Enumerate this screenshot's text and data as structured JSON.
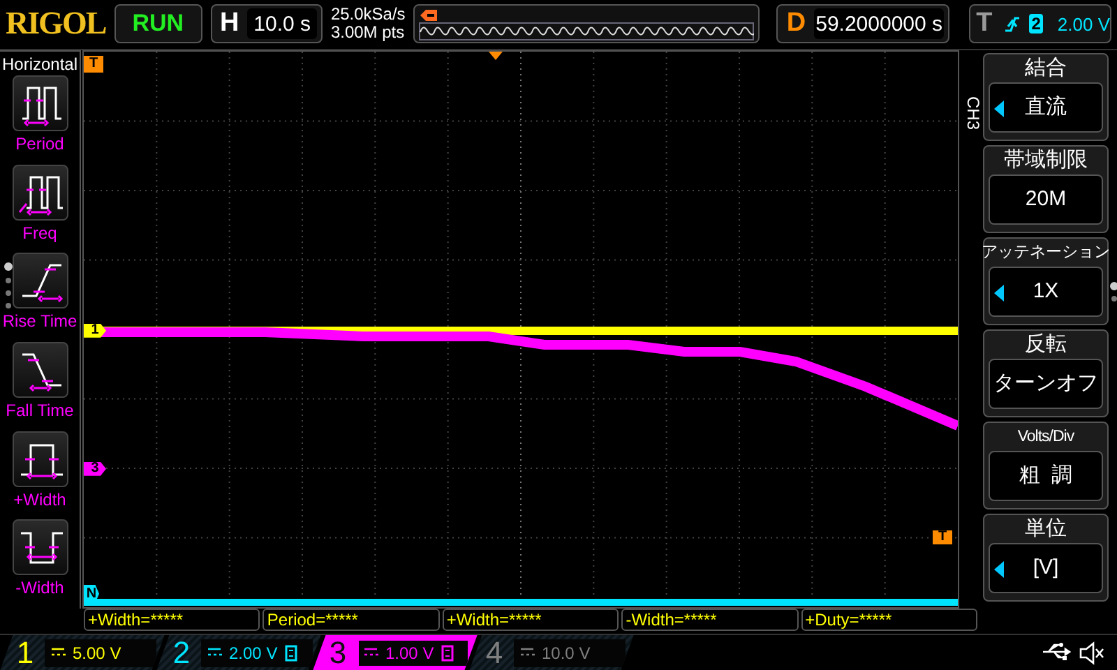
{
  "brand": "RIGOL",
  "run_state": {
    "label": "RUN",
    "running": true
  },
  "timebase": {
    "label": "H",
    "value": "10.0 s"
  },
  "acquisition": {
    "sample_rate": "25.0kSa/s",
    "memory_depth": "3.00M pts"
  },
  "delay": {
    "label": "D",
    "value": "59.2000000 s"
  },
  "trigger": {
    "label": "T",
    "source": "2",
    "level": "2.00 V",
    "color": "#00e5ff"
  },
  "measure_menu": {
    "title": "Horizontal",
    "items": [
      {
        "label": "Period",
        "kind": "period"
      },
      {
        "label": "Freq",
        "kind": "freq"
      },
      {
        "label": "Rise Time",
        "kind": "rise"
      },
      {
        "label": "Fall Time",
        "kind": "fall"
      },
      {
        "label": "+Width",
        "kind": "pwidth"
      },
      {
        "label": "-Width",
        "kind": "nwidth"
      }
    ]
  },
  "markers": [
    {
      "label": "T",
      "kind": "trigger_position",
      "color": "#ff8c00"
    },
    {
      "label": "1",
      "kind": "channel",
      "color": "#ffff00"
    },
    {
      "label": "3",
      "kind": "channel",
      "color": "#ff00ff"
    },
    {
      "label": "N",
      "kind": "channel",
      "color": "#00e5ff"
    },
    {
      "label": "T",
      "kind": "trigger_level",
      "color": "#ff8c00"
    }
  ],
  "channel_menu": {
    "channel": "CH3",
    "items": [
      {
        "title": "結合",
        "value": "直流",
        "adjustable": true
      },
      {
        "title": "帯域制限",
        "value": "20M",
        "adjustable": false
      },
      {
        "title": "アッテネーション",
        "value": "1X",
        "adjustable": true
      },
      {
        "title": "反転",
        "value": "ターンオフ",
        "adjustable": false
      },
      {
        "title": "Volts/Div",
        "value": "粗  調",
        "adjustable": false
      },
      {
        "title": "単位",
        "value": "[V]",
        "adjustable": true
      }
    ]
  },
  "measurements": [
    "+Width=*****",
    "Period=*****",
    "+Width=*****",
    "-Width=*****",
    "+Duty=*****"
  ],
  "channels": [
    {
      "number": "1",
      "scale": "5.00 V",
      "color": "#ffff00",
      "selected": false,
      "bw_limit": false
    },
    {
      "number": "2",
      "scale": "2.00 V",
      "color": "#00e5ff",
      "selected": false,
      "bw_limit": true
    },
    {
      "number": "3",
      "scale": "1.00 V",
      "color": "#ff00ff",
      "selected": true,
      "bw_limit": true
    },
    {
      "number": "4",
      "scale": "10.0 V",
      "color": "#7f7f7f",
      "selected": false,
      "bw_limit": false
    }
  ]
}
